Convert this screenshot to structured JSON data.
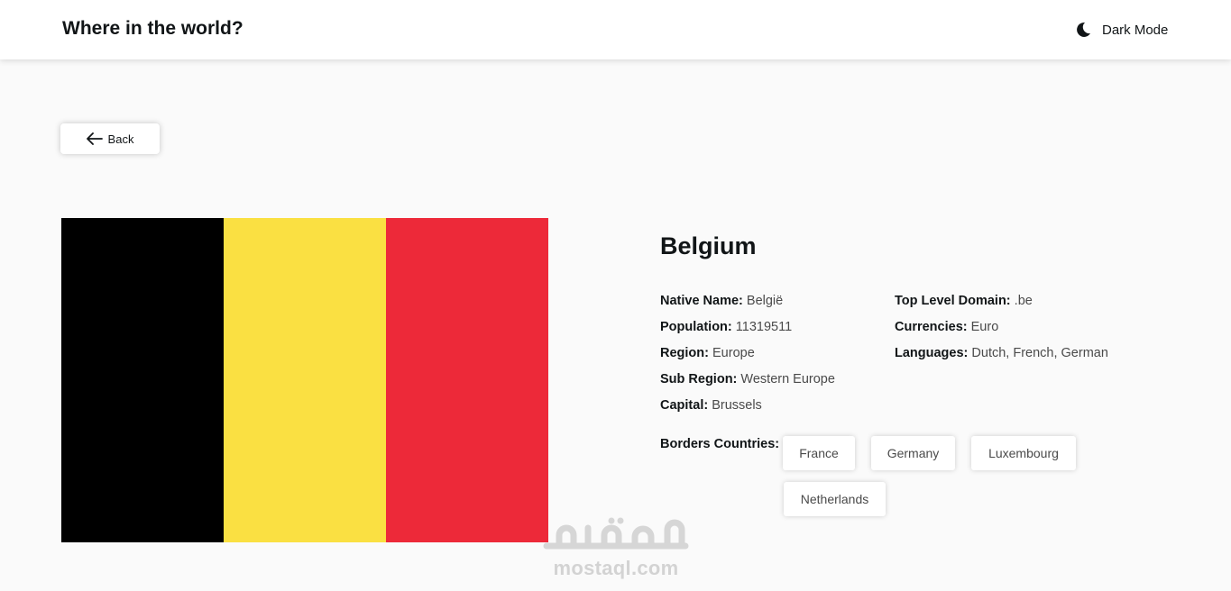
{
  "header": {
    "title": "Where in the world?",
    "mode_icon": "moon-icon",
    "mode_label": "Dark Mode"
  },
  "back": {
    "icon": "arrow-left-icon",
    "label": "Back"
  },
  "country": {
    "name": "Belgium",
    "flag": {
      "description_colors": [
        "#000000",
        "#fae042",
        "#ed2939"
      ]
    },
    "info_left": [
      {
        "key": "Native Name:",
        "value": "België"
      },
      {
        "key": "Population:",
        "value": "11319511"
      },
      {
        "key": "Region:",
        "value": "Europe"
      },
      {
        "key": "Sub Region:",
        "value": "Western Europe"
      },
      {
        "key": "Capital:",
        "value": "Brussels"
      }
    ],
    "info_right": [
      {
        "key": "Top Level Domain:",
        "value": ".be"
      },
      {
        "key": "Currencies:",
        "value": "Euro"
      },
      {
        "key": "Languages:",
        "value": "Dutch, French, German"
      }
    ],
    "borders_label": "Borders Countries:",
    "borders": [
      "France",
      "Germany",
      "Luxembourg",
      "Netherlands"
    ]
  },
  "watermark": {
    "text": "mostaql.com"
  },
  "colors": {
    "background": "#fafafa",
    "surface": "#ffffff",
    "text": "#111517"
  }
}
